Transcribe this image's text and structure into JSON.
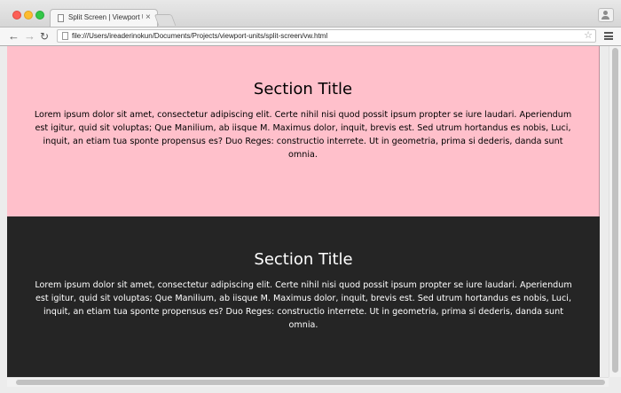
{
  "browser": {
    "tab": {
      "title": "Split Screen | Viewport Units",
      "close_glyph": "×",
      "icon": "page-icon"
    },
    "toolbar": {
      "back_glyph": "←",
      "forward_glyph": "→",
      "reload_glyph": "↻",
      "url": "file:///Users/ireaderinokun/Documents/Projects/viewport-units/split-screen/vw.html",
      "star_glyph": "☆",
      "icons": [
        "back-arrow-icon",
        "forward-arrow-icon",
        "reload-icon",
        "file-icon",
        "bookmark-star-icon",
        "menu-icon",
        "profile-icon"
      ]
    },
    "window_controls": [
      "close",
      "minimize",
      "maximize"
    ],
    "colors": {
      "close": "#fc5f57",
      "minimize": "#fdbc2e",
      "maximize": "#33c748"
    }
  },
  "page": {
    "sections": [
      {
        "title": "Section Title",
        "text": "Lorem ipsum dolor sit amet, consectetur adipiscing elit. Certe nihil nisi quod possit ipsum propter se iure laudari. Aperiendum est igitur, quid sit voluptas; Que Manilium, ab iisque M. Maximus dolor, inquit, brevis est. Sed utrum hortandus es nobis, Luci, inquit, an etiam tua sponte propensus es? Duo Reges: constructio interrete. Ut in geometria, prima si dederis, danda sunt omnia.",
        "background": "#ffc0cb",
        "color": "#000000"
      },
      {
        "title": "Section Title",
        "text": "Lorem ipsum dolor sit amet, consectetur adipiscing elit. Certe nihil nisi quod possit ipsum propter se iure laudari. Aperiendum est igitur, quid sit voluptas; Que Manilium, ab iisque M. Maximus dolor, inquit, brevis est. Sed utrum hortandus es nobis, Luci, inquit, an etiam tua sponte propensus es? Duo Reges: constructio interrete. Ut in geometria, prima si dederis, danda sunt omnia.",
        "background": "#252525",
        "color": "#ffffff"
      }
    ]
  }
}
